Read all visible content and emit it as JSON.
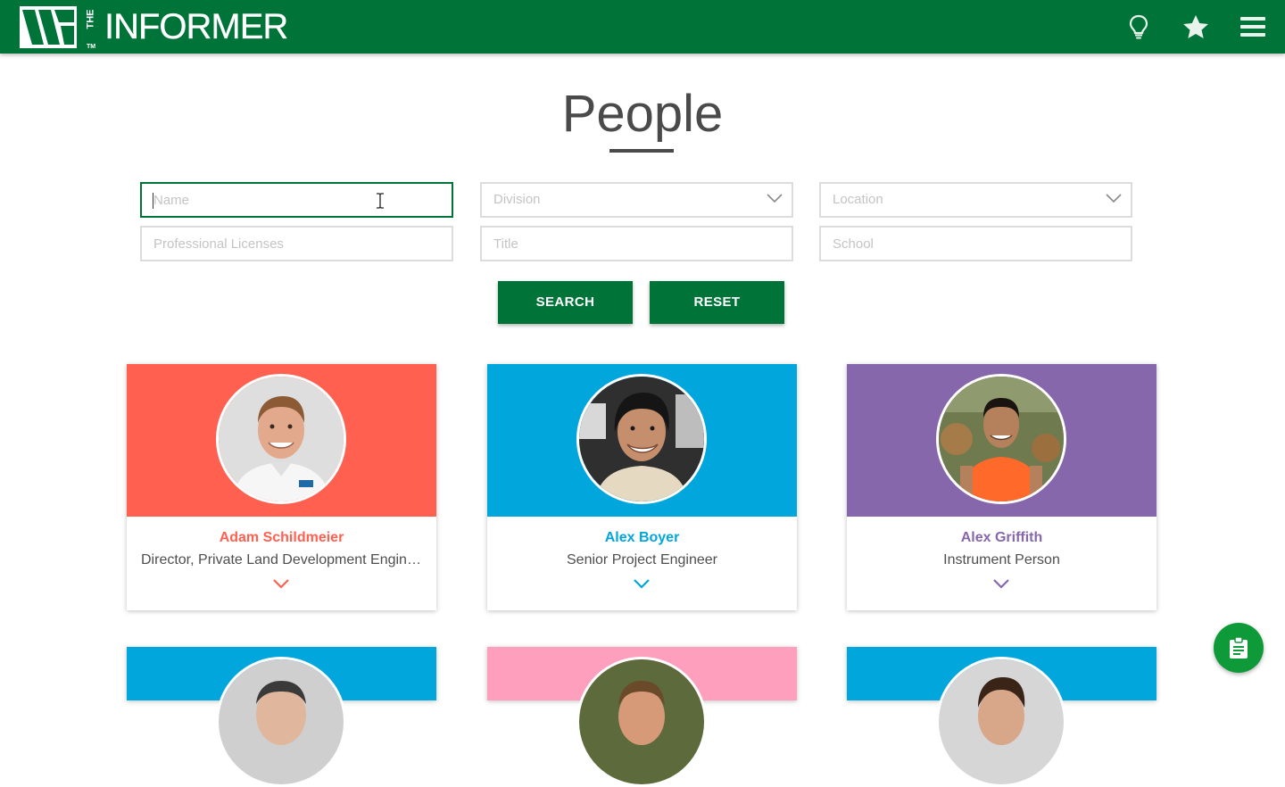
{
  "header": {
    "logo_mark": "W",
    "logo_the": "THE",
    "logo_tm": "TM",
    "logo_text": "INFORMER",
    "icons": [
      "lightbulb-icon",
      "star-icon",
      "menu-icon"
    ],
    "bg_color": "#007338"
  },
  "page": {
    "title": "People"
  },
  "filters": {
    "name_placeholder": "Name",
    "division_placeholder": "Division",
    "location_placeholder": "Location",
    "licenses_placeholder": "Professional Licenses",
    "title_placeholder": "Title",
    "school_placeholder": "School"
  },
  "buttons": {
    "search": "SEARCH",
    "reset": "RESET"
  },
  "people": [
    {
      "name": "Adam Schildmeier",
      "title": "Director, Private Land Development Engineering",
      "color": "#ff604f",
      "shirt": "#f4f4f4",
      "skin": "#e2a98c",
      "bg": "#dcdcdc"
    },
    {
      "name": "Alex Boyer",
      "title": "Senior Project Engineer",
      "color": "#00a6dc",
      "shirt": "#e8dcc8",
      "skin": "#c58e6c",
      "bg": "#3a3a3a"
    },
    {
      "name": "Alex Griffith",
      "title": "Instrument Person",
      "color": "#8667ab",
      "shirt": "#ff6a2a",
      "skin": "#b5805c",
      "bg": "#6f7b4e"
    },
    {
      "name": "",
      "title": "",
      "color": "#00a6dc",
      "shirt": "#555",
      "skin": "#e0b79c",
      "bg": "#c9c9c9"
    },
    {
      "name": "",
      "title": "",
      "color": "#ff9fbe",
      "shirt": "#555",
      "skin": "#d69a78",
      "bg": "#5c6a3c"
    },
    {
      "name": "",
      "title": "",
      "color": "#00a6dc",
      "shirt": "#555",
      "skin": "#d8a688",
      "bg": "#cfcfcf"
    }
  ],
  "fab": {
    "icon": "clipboard-icon"
  }
}
